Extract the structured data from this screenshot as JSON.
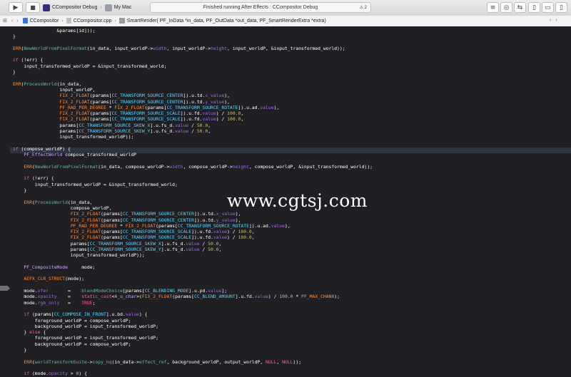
{
  "toolbar": {
    "scheme_name": "CCompositor Debug",
    "destination": "My Mac",
    "status_text": "Finished running After Effects : CCompositor Debug",
    "warning_count": "2"
  },
  "jumpbar": {
    "project": "CCompositor",
    "file": "CCompositor.cpp",
    "function": "SmartRender( PF_InData *in_data, PF_OutData *out_data, PF_SmartRenderExtra *extra)"
  },
  "watermark": "www.cgtsj.com",
  "code_lines": [
    "                &params[id]));",
    "}",
    "",
    "ERR(NewWorldFromPixelFormat(in_data, input_worldP->width, input_worldP->height, input_worldP, &input_transformed_world));",
    "",
    "if (!err) {",
    "    input_transformed_worldP = &input_transformed_world;",
    "}",
    "",
    "ERR(ProcessWorld(in_data,",
    "                 input_worldP,",
    "                 FIX_2_FLOAT(params[CC_TRANSFORM_SOURCE_CENTER]).u.td.x_value),",
    "                 FIX_2_FLOAT(params[CC_TRANSFORM_SOURCE_CENTER]).u.td.y_value),",
    "                 PF_RAD_PER_DEGREE * FIX_2_FLOAT(params[CC_TRANSFORM_SOURCE_ROTATE]).u.ad.value),",
    "                 FIX_2_FLOAT(params[CC_TRANSFORM_SOURCE_SCALE]).u.fd.value) / 100.0,",
    "                 FIX_2_FLOAT(params[CC_TRANSFORM_SOURCE_SCALE]).u.fd.value) / 100.0,",
    "                 params[CC_TRANSFORM_SOURCE_SKEW_X].u.fs_d.value / 50.0,",
    "                 params[CC_TRANSFORM_SOURCE_SKEW_Y].u.fs_d.value / 50.0,",
    "                 input_transformed_worldP));",
    "",
    "if (compose_worldP) {",
    "    PF_EffectWorld compose_transformed_worldP",
    "",
    "    ERR(NewWorldFromPixelFormat(in_data, compose_worldP->width, compose_worldP->height, compose_worldP, &input_transformed_world));",
    "",
    "    if (!err) {",
    "        input_transformed_worldP = &input_transformed_world;",
    "    }",
    "",
    "    ERR(ProcessWorld(in_data,",
    "                     compose_worldP,",
    "                     FIX_2_FLOAT(params[CC_TRANSFORM_SOURCE_CENTER]).u.td.x_value),",
    "                     FIX_2_FLOAT(params[CC_TRANSFORM_SOURCE_CENTER]).u.td.y_value),",
    "                     PF_RAD_PER_DEGREE * FIX_2_FLOAT(params[CC_TRANSFORM_SOURCE_ROTATE]).u.ad.value),",
    "                     FIX_2_FLOAT(params[CC_TRANSFORM_SOURCE_SCALE]).u.fd.value) / 100.0,",
    "                     FIX_2_FLOAT(params[CC_TRANSFORM_SOURCE_SCALE]).u.fd.value) / 100.0,",
    "                     params[CC_TRANSFORM_SOURCE_SKEW_X].u.fs_d.value / 50.0,",
    "                     params[CC_TRANSFORM_SOURCE_SKEW_Y].u.fs_d.value / 50.0,",
    "                     input_transformed_worldP));",
    "",
    "    PF_CompositeMode     mode;",
    "",
    "    AEFX_CLR_STRUCT(mode);",
    "",
    "    mode.xfer       =    blendModeChoice[params[CC_BLENDING_MODE].u.pd.value];",
    "    mode.opacity    =    static_cast<A_u_char>(FIX_2_FLOAT(params[CC_BLEND_AMOUNT].u.fd.value) / 100.0 * PF_MAX_CHAN8);",
    "    mode.rgb_only   =    TRUE;",
    "",
    "    if (params[CC_COMPOSE_IN_FRONT].u.bd.value) {",
    "        foreground_worldP = compose_worldP;",
    "        background_worldP = input_transformed_worldP;",
    "    } else {",
    "        foreground_worldP = input_transformed_worldP;",
    "        background_worldP = compose_worldP;",
    "    }",
    "",
    "    ERR(worldTransformSuite->copy_hq(in_data->effect_ref, background_worldP, output_worldP, NULL, NULL));",
    "",
    "    if (mode.opacity > 0) {"
  ]
}
